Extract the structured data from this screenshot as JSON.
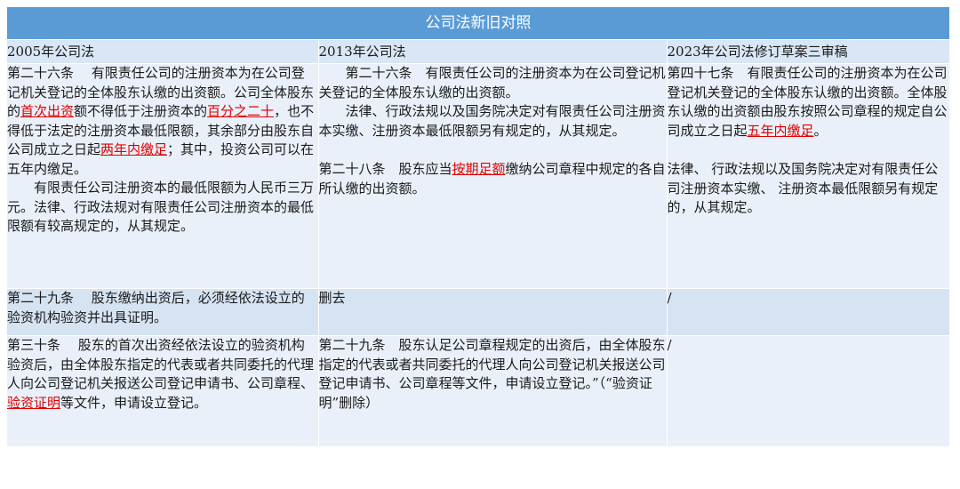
{
  "title": "公司法新旧对照",
  "columns": [
    "2005年公司法",
    "2013年公司法",
    "2023年公司法修订草案三审稿"
  ],
  "rows": [
    {
      "c2005": {
        "p1_a": "第二十六条　 有限责任公司的注册资本为在公司登记机关登记的全体股东认缴的出资额。公司全体股东的",
        "p1_h1": "首次出资",
        "p1_b": "额不得低于注册资本的",
        "p1_h2": "百分之二十",
        "p1_c": "，也不得低于法定的注册资本最低限额，其余部分由股东自公司成立之日起",
        "p1_h3": "两年内缴足",
        "p1_d": "；其中，投资公司可以在五年内缴足。",
        "p2": "有限责任公司注册资本的最低限额为人民币三万元。法律、行政法规对有限责任公司注册资本的最低限额有较高规定的，从其规定。"
      },
      "c2013": {
        "p1": "第二十六条　有限责任公司的注册资本为在公司登记机关登记的全体股东认缴的出资额。",
        "p2": "法律、行政法规以及国务院决定对有限责任公司注册资本实缴、注册资本最低限额另有规定的，从其规定。",
        "p3_a": "第二十八条　股东应当",
        "p3_h": "按期足额",
        "p3_b": "缴纳公司章程中规定的各自所认缴的出资额。"
      },
      "c2023": {
        "p1_a": "第四十七条　有限责任公司的注册资本为在公司登记机关登记的全体股东认缴的出资额。全体股东认缴的出资额由股东按照公司章程的规定自公司成立之日起",
        "p1_h": "五年内缴足",
        "p1_b": "。",
        "p2": "法律、 行政法规以及国务院决定对有限责任公司注册资本实缴、 注册资本最低限额另有规定的，从其规定。"
      }
    },
    {
      "c2005": "第二十九条　 股东缴纳出资后，必须经依法设立的验资机构验资并出具证明。",
      "c2013": "删去",
      "c2023": "/"
    },
    {
      "c2005": {
        "a": "第三十条　 股东的首次出资经依法设立的验资机构验资后，由全体股东指定的代表或者共同委托的代理人向公司登记机关报送公司登记申请书、公司章程、",
        "h": "验资证明",
        "b": "等文件，申请设立登记。"
      },
      "c2013": "第二十九条　股东认足公司章程规定的出资后，由全体股东指定的代表或者共同委托的代理人向公司登记机关报送公司登记申请书、公司章程等文件，申请设立登记。”（“验资证明”删除）",
      "c2023": "/"
    }
  ]
}
